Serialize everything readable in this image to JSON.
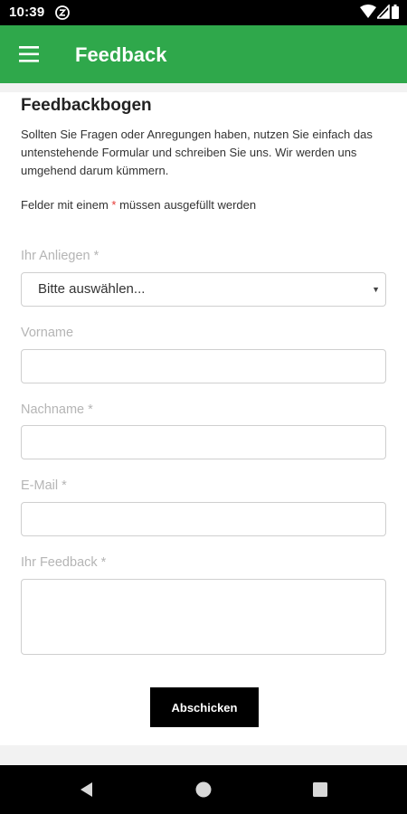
{
  "status_bar": {
    "time": "10:39",
    "icons": [
      "app-notification-icon",
      "wifi-icon",
      "signal-icon",
      "battery-icon"
    ]
  },
  "app_bar": {
    "title": "Feedback",
    "menu_icon": "hamburger-menu-icon",
    "color": "#2fa84b"
  },
  "page": {
    "title": "Feedbackbogen",
    "intro": "Sollten Sie Fragen oder Anregungen haben, nutzen Sie einfach das untenstehende Formular und schreiben Sie uns. Wir werden uns umgehend darum kümmern.",
    "required_note_before": "Felder mit einem ",
    "required_star": "*",
    "required_note_after": " müssen ausgefüllt werden"
  },
  "form": {
    "concern": {
      "label": "Ihr Anliegen *",
      "selected": "Bitte auswählen..."
    },
    "first_name": {
      "label": "Vorname",
      "value": ""
    },
    "last_name": {
      "label": "Nachname *",
      "value": ""
    },
    "email": {
      "label": "E-Mail *",
      "value": ""
    },
    "feedback": {
      "label": "Ihr Feedback *",
      "value": ""
    },
    "submit_label": "Abschicken"
  },
  "nav_bar": {
    "icons": [
      "back-icon",
      "home-icon",
      "recents-icon"
    ]
  },
  "colors": {
    "accent": "#2fa84b",
    "required_star": "#e53935",
    "button": "#000000"
  }
}
